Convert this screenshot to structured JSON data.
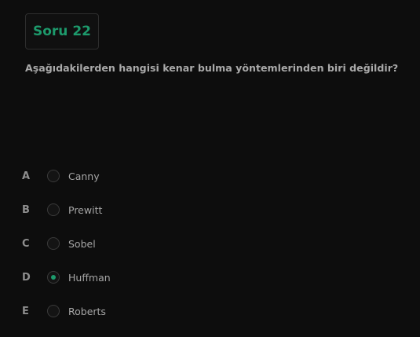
{
  "question": {
    "badge": "Soru 22",
    "text": "Aşağıdakilerden hangisi kenar bulma yöntemlerinden biri değildir?"
  },
  "options": [
    {
      "letter": "A",
      "label": "Canny",
      "selected": false
    },
    {
      "letter": "B",
      "label": "Prewitt",
      "selected": false
    },
    {
      "letter": "C",
      "label": "Sobel",
      "selected": false
    },
    {
      "letter": "D",
      "label": "Huffman",
      "selected": true
    },
    {
      "letter": "E",
      "label": "Roberts",
      "selected": false
    }
  ],
  "colors": {
    "accent": "#1d9a6c",
    "background": "#0d0d0d"
  }
}
